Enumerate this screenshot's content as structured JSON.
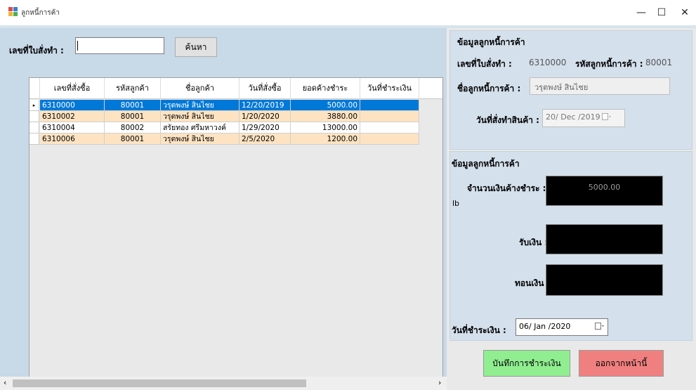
{
  "window": {
    "title": "ลูกหนี้การค้า",
    "minimize_glyph": "—",
    "maximize_glyph": "☐",
    "close_glyph": "✕"
  },
  "search": {
    "label": "เลขที่ใบสั่งทำ :",
    "value": "",
    "button_label": "ค้นหา"
  },
  "grid": {
    "columns": [
      "เลขที่สั่งซื้อ",
      "รหัสลูกค้า",
      "ชื่อลูกค้า",
      "วันที่สั่งซื้อ",
      "ยอดค้างชำระ",
      "วันที่ชำระเงิน"
    ],
    "rows": [
      [
        "6310000",
        "80001",
        "วรุตพงษ์ สินไชย",
        "12/20/2019",
        "5000.00",
        ""
      ],
      [
        "6310002",
        "80001",
        "วรุตพงษ์ สินไชย",
        "1/20/2020",
        "3880.00",
        ""
      ],
      [
        "6310004",
        "80002",
        "สรัยทอง ศรีมหาวงค์",
        "1/29/2020",
        "13000.00",
        ""
      ],
      [
        "6310006",
        "80001",
        "วรุตพงษ์ สินไชย",
        "2/5/2020",
        "1200.00",
        ""
      ]
    ],
    "row_indicator": "▸"
  },
  "debtor_info": {
    "heading": "ข้อมูลลูกหนี้การค้า",
    "order_label": "เลขที่ใบสั่งทำ :",
    "order_value": "6310000",
    "code_label": "รหัสลูกหนี้การค้า :",
    "code_value": "80001",
    "name_label": "ชื่อลูกหนี้การค้า :",
    "name_value": "วรุตพงษ์ สินไชย",
    "date_label": "วันที่สั่งทำสินค้า :",
    "date_value": "20/ Dec /2019"
  },
  "payment": {
    "heading": "ข้อมูลลูกหนี้การค้า",
    "outstanding_label": "จำนวนเงินค้างชำระ :",
    "outstanding_value": "5000.00",
    "unit_label": "lb",
    "received_label": "รับเงิน :",
    "received_value": "",
    "change_label": "ทอนเงิน :",
    "change_value": "",
    "pay_date_label": "วันที่ชำระเงิน :",
    "pay_date_value": "06/ Jan /2020"
  },
  "actions": {
    "save_label": "บันทึกการชำระเงิน",
    "exit_label": "ออกจากหน้านี้"
  },
  "colors": {
    "selected_row": "#0078d7",
    "alt_row": "#fde3c2",
    "save_button": "#90ee90",
    "exit_button": "#f08080"
  }
}
